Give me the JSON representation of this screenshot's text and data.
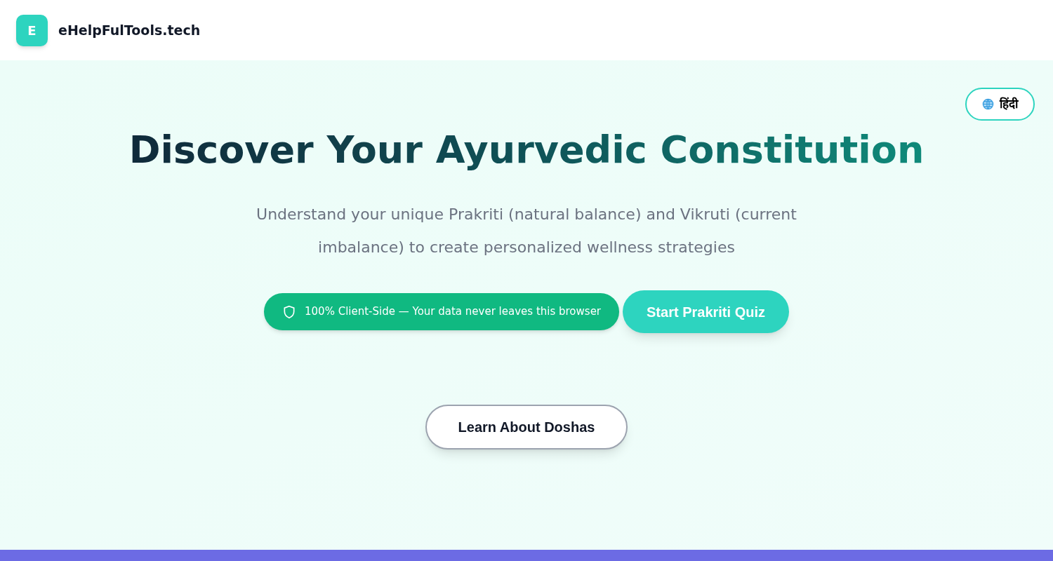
{
  "header": {
    "logo_letter": "E",
    "site_name": "eHelpFulTools.tech"
  },
  "language_button": {
    "label": "हिंदी"
  },
  "hero": {
    "title": "Discover Your Ayurvedic Constitution",
    "subtitle": "Understand your unique Prakriti (natural balance) and Vikruti (current imbalance) to create personalized wellness strategies",
    "privacy_badge": "100% Client-Side — Your data never leaves this browser",
    "primary_button": "Start Prakriti Quiz",
    "secondary_button": "Learn About Doshas"
  }
}
